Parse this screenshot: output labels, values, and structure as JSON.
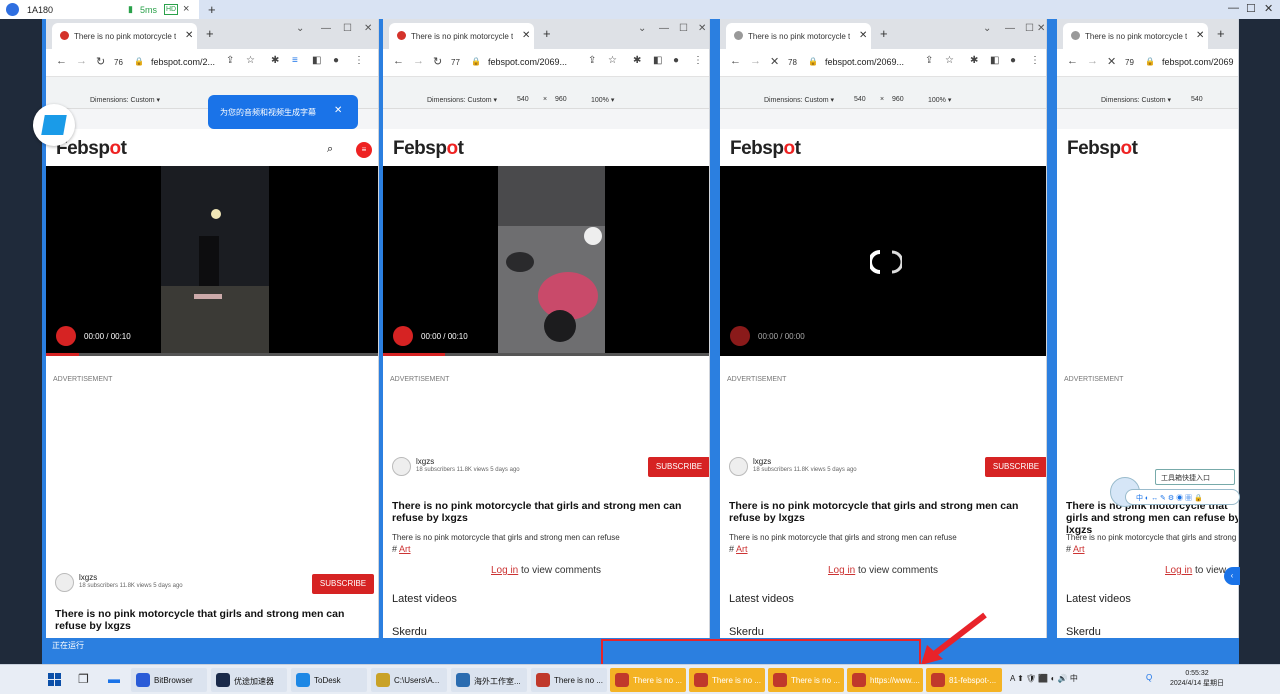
{
  "outer": {
    "device_name": "1A180",
    "latency": "5ms",
    "hd": "HD",
    "tab_close": "×",
    "plus": "+"
  },
  "browsers": [
    {
      "tab_title": "There is no pink motorcycle t",
      "reload_num": "76",
      "url": "febspot.com/2...",
      "dim_label": "Dimensions: Custom ▾",
      "width": "",
      "height": "",
      "zoom": "",
      "time": "00:00 / 00:10",
      "popup_text": "为您的音频和视频生成字幕"
    },
    {
      "tab_title": "There is no pink motorcycle t",
      "reload_num": "77",
      "url": "febspot.com/2069...",
      "dim_label": "Dimensions: Custom ▾",
      "width": "540",
      "height": "960",
      "zoom": "100% ▾",
      "time": "00:00 / 00:10"
    },
    {
      "tab_title": "There is no pink motorcycle t",
      "reload_num": "78",
      "url": "febspot.com/2069...",
      "dim_label": "Dimensions: Custom ▾",
      "width": "540",
      "height": "960",
      "zoom": "100% ▾",
      "time": "00:00 / 00:00"
    },
    {
      "tab_title": "There is no pink motorcycle t",
      "reload_num": "79",
      "url": "febspot.com/2069",
      "dim_label": "Dimensions: Custom ▾",
      "width": "540",
      "height": "",
      "zoom": "",
      "time": ""
    }
  ],
  "page": {
    "logo_pre": "Febsp",
    "logo_o": "o",
    "logo_post": "t",
    "advertisement": "ADVERTISEMENT",
    "channel": "lxgzs",
    "channel_meta": "18 subscribers     11.8K views     5 days ago",
    "subscribe": "SUBSCRIBE",
    "title": "There is no pink motorcycle that girls and strong men can refuse by lxgzs",
    "description": "There is no pink motorcycle that girls and strong men can refuse",
    "tag_hash": "#",
    "tag": "Art",
    "login_link": "Log in",
    "login_rest": " to view comments",
    "latest": "Latest videos",
    "skerdu": "Skerdu"
  },
  "bottom_strip_text": "正在运行",
  "toolbox": {
    "label": "工具箱快捷入口",
    "bar": "中 ◐ ↔ ✎ ⚙ ◉ ▦ 🔒"
  },
  "taskbar": {
    "apps": [
      {
        "label": "BitBrowser",
        "color": "#2a5bd7"
      },
      {
        "label": "优途加速器",
        "color": "#1a2a4a"
      },
      {
        "label": "ToDesk",
        "color": "#1e88e5"
      },
      {
        "label": "C:\\Users\\A...",
        "color": "#c9a227"
      },
      {
        "label": "海外工作室...",
        "color": "#2b6cb0"
      },
      {
        "label": "There is no ...",
        "color": "#c0392b"
      },
      {
        "label": "There is no ...",
        "color": "#c0392b"
      },
      {
        "label": "There is no ...",
        "color": "#c0392b"
      },
      {
        "label": "There is no ...",
        "color": "#c0392b"
      },
      {
        "label": "https://www....",
        "color": "#c0392b"
      },
      {
        "label": "81-febspot-...",
        "color": "#c0392b"
      }
    ],
    "tray": "A ⬆ 🛡 ⬛ ◐ 🔊 中",
    "time": "0:55:32",
    "date": "2024/4/14 星期日"
  },
  "colors": {
    "accent": "#d62323",
    "desktop_blue": "#2b7fe0",
    "highlight": "#f4b324",
    "annotation": "#e8232a"
  }
}
